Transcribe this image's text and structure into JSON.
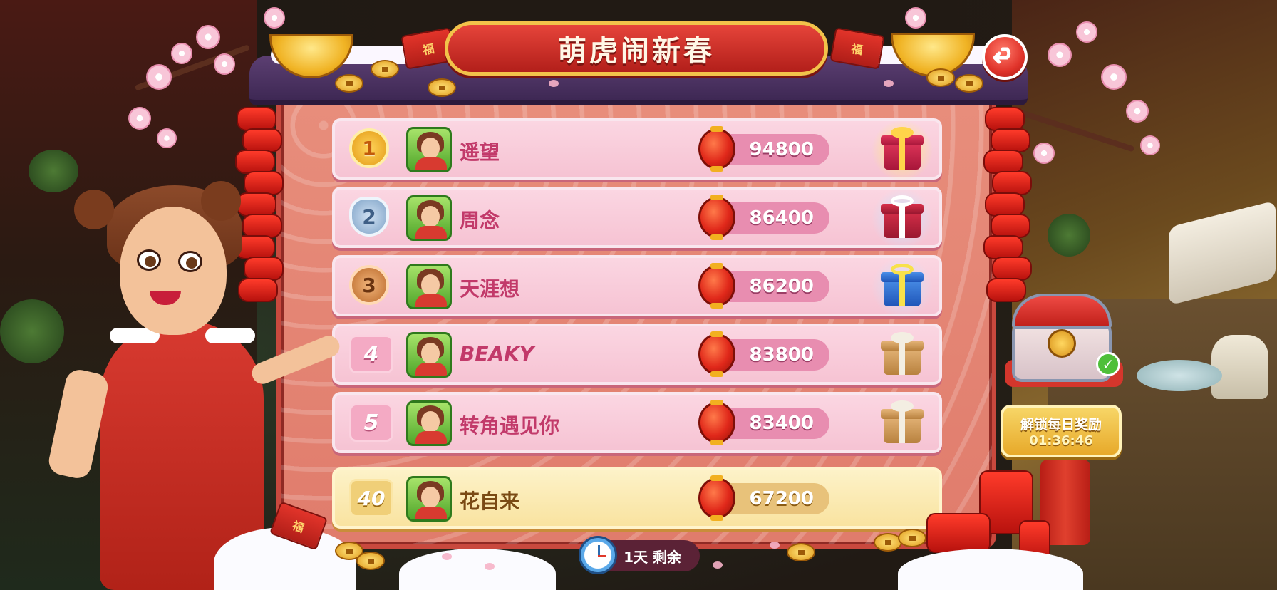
{
  "event": {
    "title": "萌虎闹新春",
    "time_left": "1天 剩余"
  },
  "leaderboard": [
    {
      "rank": "1",
      "medal": "gold",
      "name": "遥望",
      "score": "94800",
      "reward": "gift-gold"
    },
    {
      "rank": "2",
      "medal": "silver",
      "name": "周念",
      "score": "86400",
      "reward": "gift-silver"
    },
    {
      "rank": "3",
      "medal": "bronze",
      "name": "天涯想",
      "score": "86200",
      "reward": "gift-blue"
    },
    {
      "rank": "4",
      "medal": "none",
      "name": "BEAKY",
      "score": "83800",
      "reward": "gift-plain"
    },
    {
      "rank": "5",
      "medal": "none",
      "name": "转角遇见你",
      "score": "83400",
      "reward": "gift-plain"
    }
  ],
  "my_entry": {
    "rank": "40",
    "name": "花自来",
    "score": "67200"
  },
  "daily_reward": {
    "label": "解锁每日奖励",
    "countdown": "01:36:46"
  },
  "icons": {
    "back": "undo-arrow-icon",
    "score": "red-lantern-icon",
    "timer": "clock-icon",
    "chest": "treasure-chest-icon",
    "check": "checkmark-icon"
  },
  "colors": {
    "banner_red": "#c9302a",
    "banner_gold_border": "#f2c24a",
    "row_pink": "#f8cad8",
    "row_highlight": "#fbe8b0",
    "name_pink": "#c23a6a"
  }
}
